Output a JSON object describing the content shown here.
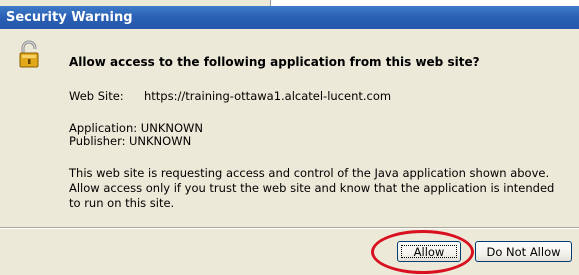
{
  "dialog": {
    "title": "Security Warning",
    "heading": "Allow access to the following application from this web site?",
    "website_label": "Web Site:",
    "website_value": "https://training-ottawa1.alcatel-lucent.com",
    "application_label": "Application:",
    "application_value": "UNKNOWN",
    "publisher_label": "Publisher:",
    "publisher_value": "UNKNOWN",
    "description": "This web site is requesting access and control of the Java application shown above. Allow access only if you trust the web site and know that the application is intended to run on this site."
  },
  "buttons": {
    "allow_label": "Allow",
    "deny_label": "Do Not Allow"
  },
  "icons": {
    "warning": "padlock-warning-icon"
  },
  "colors": {
    "titlebar": "#2a5fb3",
    "highlight": "#d81020",
    "background": "#ece9d8"
  }
}
